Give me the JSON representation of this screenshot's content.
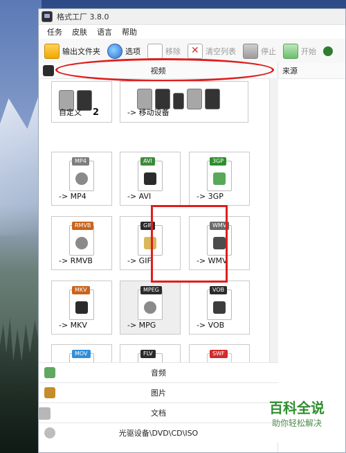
{
  "window": {
    "title": "格式工厂 3.8.0"
  },
  "menu": {
    "items": [
      "任务",
      "皮肤",
      "语言",
      "帮助"
    ]
  },
  "toolbar": {
    "output_folder": "输出文件夹",
    "options": "选项",
    "remove": "移除",
    "clear_list": "清空列表",
    "stop": "停止",
    "start": "开始"
  },
  "categories": {
    "video": "视频",
    "audio": "音频",
    "image": "图片",
    "document": "文档",
    "disc": "光驱设备\\DVD\\CD\\ISO"
  },
  "video_tiles": {
    "custom": {
      "label": "自定义",
      "annotation": "2"
    },
    "mobile": {
      "label": "-> 移动设备"
    },
    "mp4": {
      "label": "-> MP4",
      "tag": "MP4"
    },
    "avi": {
      "label": "-> AVI",
      "tag": "AVI"
    },
    "3gp": {
      "label": "-> 3GP",
      "tag": "3GP"
    },
    "rmvb": {
      "label": "-> RMVB",
      "tag": "RMVB"
    },
    "gif": {
      "label": "-> GIF",
      "tag": "GIF"
    },
    "wmv": {
      "label": "-> WMV",
      "tag": "WMV"
    },
    "mkv": {
      "label": "-> MKV",
      "tag": "MKV"
    },
    "mpg": {
      "label": "-> MPG",
      "tag": "MPEG"
    },
    "vob": {
      "label": "-> VOB",
      "tag": "VOB"
    },
    "mov": {
      "label": "",
      "tag": "MOV"
    },
    "flv": {
      "label": "",
      "tag": "FLV"
    },
    "swf": {
      "label": "",
      "tag": "SWF"
    }
  },
  "right_panel": {
    "source_label": "来源"
  },
  "watermark": {
    "line1": "百科全说",
    "line2": "助你轻松解决"
  },
  "colors": {
    "highlight_red": "#e01d1d",
    "accent_green": "#2e8f2e"
  }
}
